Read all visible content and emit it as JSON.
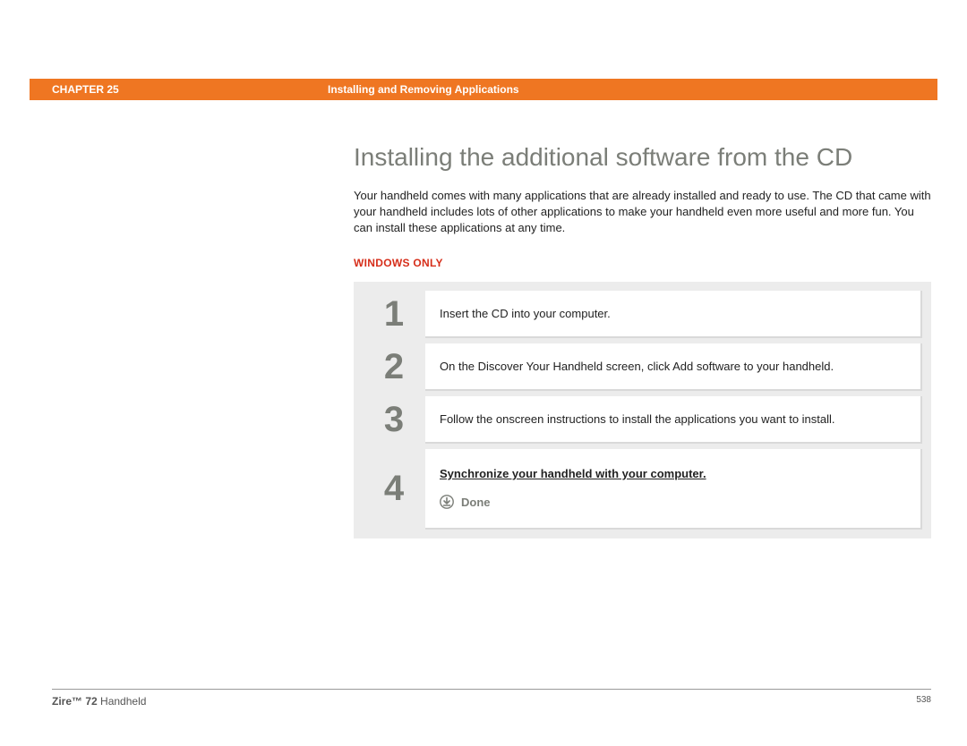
{
  "header": {
    "chapter": "CHAPTER 25",
    "section": "Installing and Removing Applications"
  },
  "title": "Installing the additional software from the CD",
  "intro": "Your handheld comes with many applications that are already installed and ready to use. The CD that came with your handheld includes lots of other applications to make your handheld even more useful and more fun. You can install these applications at any time.",
  "platform_label": "WINDOWS ONLY",
  "steps": [
    {
      "num": "1",
      "text": "Insert the CD into your computer."
    },
    {
      "num": "2",
      "text": "On the Discover Your Handheld screen, click Add software to your handheld."
    },
    {
      "num": "3",
      "text": "Follow the onscreen instructions to install the applications you want to install."
    }
  ],
  "final_step": {
    "num": "4",
    "link_text": "Synchronize your handheld with your computer.",
    "done_label": "Done"
  },
  "footer": {
    "product_bold": "Zire™ 72",
    "product_rest": " Handheld",
    "page": "538"
  }
}
